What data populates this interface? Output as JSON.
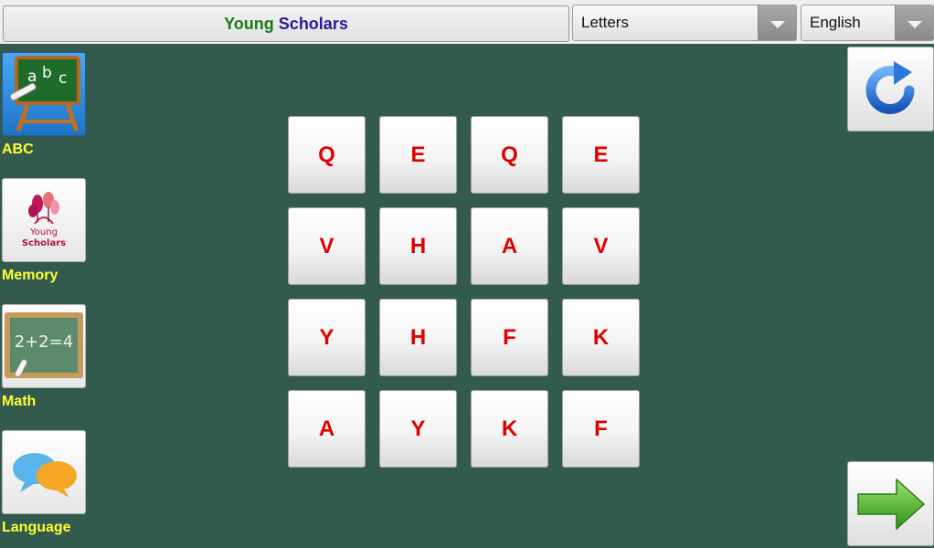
{
  "header": {
    "title_part1": "Young",
    "title_part2": "Scholars",
    "mode_select": "Letters",
    "language_select": "English"
  },
  "sidebar": {
    "items": [
      {
        "label": "ABC",
        "icon": "abc-chalkboard-icon",
        "active": true
      },
      {
        "label": "Memory",
        "icon": "young-scholars-logo-icon",
        "logo_text": [
          "Young",
          "Scholars"
        ]
      },
      {
        "label": "Math",
        "icon": "math-slate-icon",
        "slate_text": "2+2=4"
      },
      {
        "label": "Language",
        "icon": "speech-bubbles-icon"
      }
    ]
  },
  "grid": {
    "rows": [
      [
        "Q",
        "E",
        "Q",
        "E"
      ],
      [
        "V",
        "H",
        "A",
        "V"
      ],
      [
        "Y",
        "H",
        "F",
        "K"
      ],
      [
        "A",
        "Y",
        "K",
        "F"
      ]
    ]
  },
  "actions": {
    "refresh_icon": "refresh-icon",
    "next_icon": "next-arrow-icon"
  },
  "colors": {
    "background": "#325a4d",
    "letter": "#e00000",
    "sidebar_label": "#ffff33",
    "title_young": "#1a7a1a",
    "title_scholars": "#2a1a9a"
  }
}
